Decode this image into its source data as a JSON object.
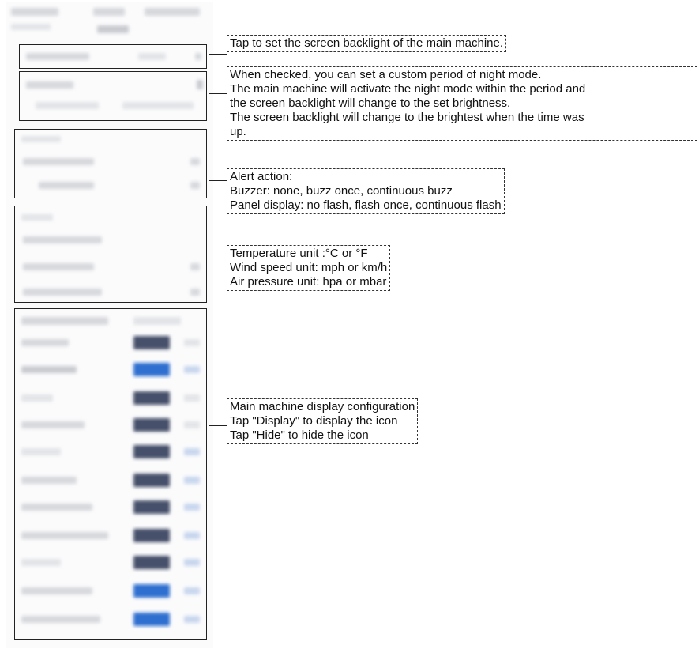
{
  "callouts": {
    "backlight": {
      "lines": [
        "Tap to set the screen backlight of the main machine."
      ]
    },
    "night_mode": {
      "lines": [
        "When checked, you can set a custom period of night mode.",
        "The main machine will activate the night mode within the period and",
        "the screen backlight will change to the set brightness.",
        "The screen backlight will change to the brightest when the time was",
        "up."
      ]
    },
    "alert": {
      "lines": [
        "Alert action:",
        "Buzzer: none, buzz once, continuous buzz",
        "Panel display: no flash, flash once, continuous flash"
      ]
    },
    "units": {
      "lines": [
        "Temperature unit :°C or °F",
        "Wind speed unit: mph or km/h",
        "Air pressure unit: hpa or mbar"
      ]
    },
    "display_config": {
      "lines": [
        "Main machine display configuration",
        "Tap \"Display\" to display the icon",
        "Tap \"Hide\" to hide the icon"
      ]
    }
  }
}
